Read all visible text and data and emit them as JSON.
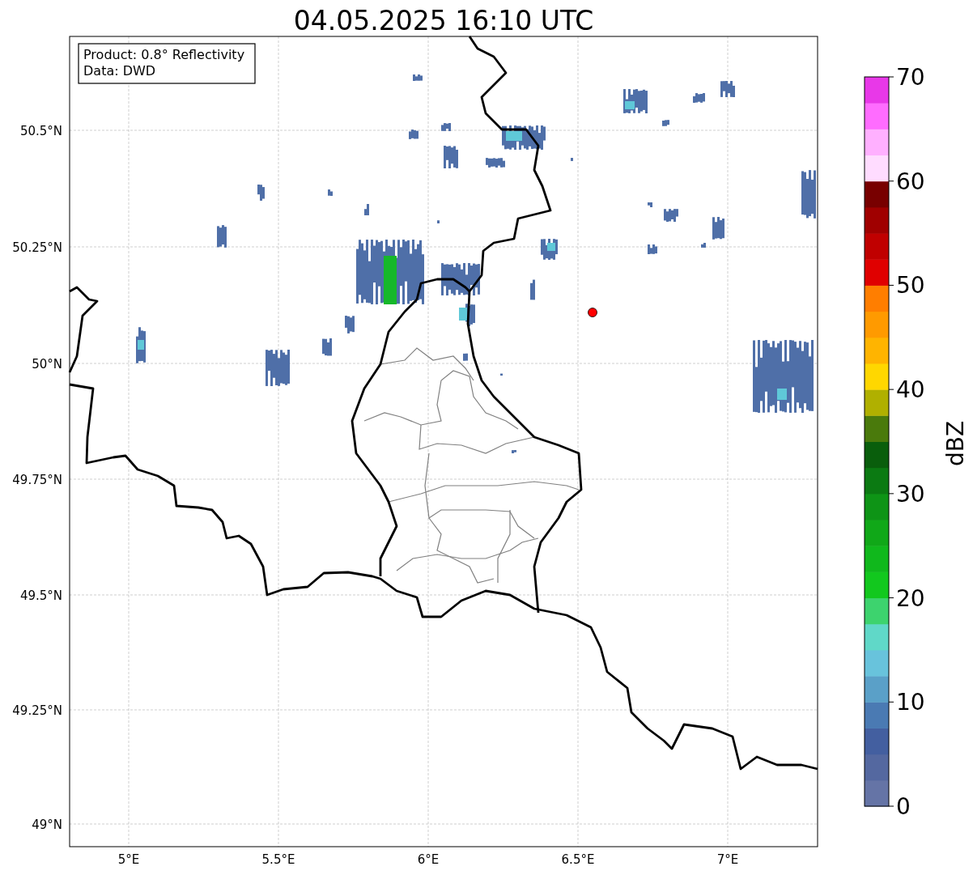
{
  "title": "04.05.2025 16:10 UTC",
  "map": {
    "info_box": [
      "Product: 0.8° Reflectivity",
      "Data: DWD"
    ],
    "lat_ticks": [
      "50.5°N",
      "50.25°N",
      "50°N",
      "49.75°N",
      "49.5°N",
      "49.25°N",
      "49°N"
    ],
    "lon_ticks": [
      "5°E",
      "5.5°E",
      "6°E",
      "6.5°E",
      "7°E"
    ]
  },
  "colorbar": {
    "label": "dBZ",
    "ticks": [
      "70",
      "60",
      "50",
      "40",
      "30",
      "20",
      "10",
      "0"
    ],
    "segments": [
      {
        "color": "#6574a6"
      },
      {
        "color": "#5468a0"
      },
      {
        "color": "#435fa0"
      },
      {
        "color": "#4a7ab3"
      },
      {
        "color": "#5aa0c8"
      },
      {
        "color": "#68c3dc"
      },
      {
        "color": "#60d8c8"
      },
      {
        "color": "#3dd36e"
      },
      {
        "color": "#12c81e"
      },
      {
        "color": "#10b81c"
      },
      {
        "color": "#10a818"
      },
      {
        "color": "#0e9416"
      },
      {
        "color": "#0b7a12"
      },
      {
        "color": "#095e0c"
      },
      {
        "color": "#4a7a0c"
      },
      {
        "color": "#b0b000"
      },
      {
        "color": "#ffd700"
      },
      {
        "color": "#ffb400"
      },
      {
        "color": "#ff9a00"
      },
      {
        "color": "#ff7e00"
      },
      {
        "color": "#e00000"
      },
      {
        "color": "#c00000"
      },
      {
        "color": "#a00000"
      },
      {
        "color": "#780000"
      },
      {
        "color": "#ffdcff"
      },
      {
        "color": "#ffb0ff"
      },
      {
        "color": "#ff6cff"
      },
      {
        "color": "#e838e8"
      }
    ]
  }
}
